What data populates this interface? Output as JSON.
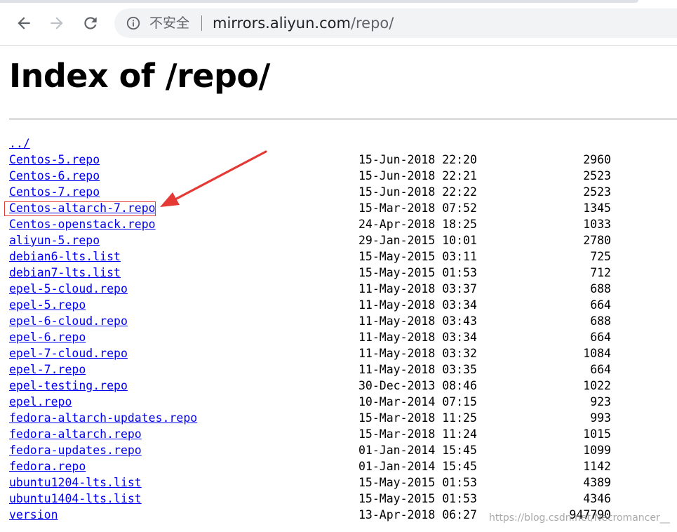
{
  "browser": {
    "security_label": "不安全",
    "url_host": "mirrors.aliyun.com",
    "url_path": "/repo/"
  },
  "page": {
    "title": "Index of /repo/",
    "parent_link": "../"
  },
  "files": [
    {
      "name": "Centos-5.repo",
      "date": "15-Jun-2018 22:20",
      "size": "2960"
    },
    {
      "name": "Centos-6.repo",
      "date": "15-Jun-2018 22:21",
      "size": "2523"
    },
    {
      "name": "Centos-7.repo",
      "date": "15-Jun-2018 22:22",
      "size": "2523"
    },
    {
      "name": "Centos-altarch-7.repo",
      "date": "15-Mar-2018 07:52",
      "size": "1345"
    },
    {
      "name": "Centos-openstack.repo",
      "date": "24-Apr-2018 18:25",
      "size": "1033"
    },
    {
      "name": "aliyun-5.repo",
      "date": "29-Jan-2015 10:01",
      "size": "2780"
    },
    {
      "name": "debian6-lts.list",
      "date": "15-May-2015 03:11",
      "size": "725"
    },
    {
      "name": "debian7-lts.list",
      "date": "15-May-2015 01:53",
      "size": "712"
    },
    {
      "name": "epel-5-cloud.repo",
      "date": "11-May-2018 03:37",
      "size": "688"
    },
    {
      "name": "epel-5.repo",
      "date": "11-May-2018 03:34",
      "size": "664"
    },
    {
      "name": "epel-6-cloud.repo",
      "date": "11-May-2018 03:43",
      "size": "688"
    },
    {
      "name": "epel-6.repo",
      "date": "11-May-2018 03:34",
      "size": "664"
    },
    {
      "name": "epel-7-cloud.repo",
      "date": "11-May-2018 03:32",
      "size": "1084"
    },
    {
      "name": "epel-7.repo",
      "date": "11-May-2018 03:35",
      "size": "664"
    },
    {
      "name": "epel-testing.repo",
      "date": "30-Dec-2013 08:46",
      "size": "1022"
    },
    {
      "name": "epel.repo",
      "date": "10-Mar-2014 07:15",
      "size": "923"
    },
    {
      "name": "fedora-altarch-updates.repo",
      "date": "15-Mar-2018 11:25",
      "size": "993"
    },
    {
      "name": "fedora-altarch.repo",
      "date": "15-Mar-2018 11:24",
      "size": "1015"
    },
    {
      "name": "fedora-updates.repo",
      "date": "01-Jan-2014 15:45",
      "size": "1099"
    },
    {
      "name": "fedora.repo",
      "date": "01-Jan-2014 15:45",
      "size": "1142"
    },
    {
      "name": "ubuntu1204-lts.list",
      "date": "15-May-2015 01:53",
      "size": "4389"
    },
    {
      "name": "ubuntu1404-lts.list",
      "date": "15-May-2015 01:53",
      "size": "4346"
    },
    {
      "name": "version",
      "date": "13-Apr-2018 06:27",
      "size": "947790"
    }
  ],
  "watermark": "https://blog.csdn.net/Necromancer__",
  "colors": {
    "link": "#0000ee",
    "annotation": "#e53935"
  }
}
